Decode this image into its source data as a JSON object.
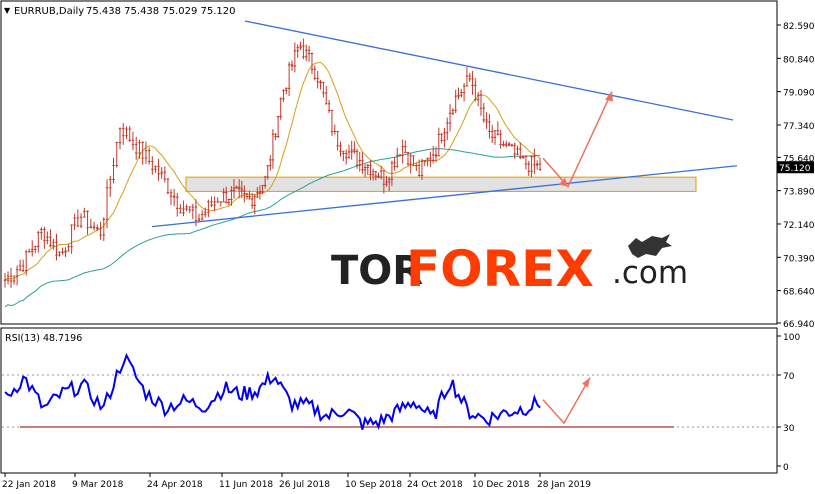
{
  "header": {
    "symbol": "EURRUB,Daily",
    "ohlc": "75.438 75.438 75.029 75.120"
  },
  "price_panel": {
    "ticks": [
      "82.590",
      "80.840",
      "79.090",
      "77.340",
      "75.640",
      "73.890",
      "72.140",
      "70.390",
      "68.640",
      "66.940"
    ],
    "current_price": "75.120"
  },
  "rsi_panel": {
    "label": "RSI(13) 48.7196",
    "levels": [
      "100",
      "70",
      "30",
      "0"
    ]
  },
  "x_ticks": [
    "22 Jan 2018",
    "9 Mar 2018",
    "24 Apr 2018",
    "11 Jun 2018",
    "26 Jul 2018",
    "10 Sep 2018",
    "24 Oct 2018",
    "10 Dec 2018",
    "28 Jan 2019"
  ],
  "watermark": {
    "part1": "TOR",
    "part2": "FOREX",
    "part3": ".com"
  },
  "colors": {
    "trendline": "#3a6fd8",
    "ma_fast": "#d4a017",
    "ma_slow": "#2aa198",
    "zone_fill": "#cfcfcf",
    "zone_border": "#e0a000",
    "forecast_arrow": "#f07060",
    "rsi_line": "#0000ee",
    "rsi_support": "#a03030",
    "candles": "#c0392b",
    "watermark_dark": "#222222",
    "watermark_accent": "#ff3c00"
  },
  "chart_data": {
    "type": "candlestick",
    "instrument": "EURRUB",
    "timeframe": "Daily",
    "ylim": [
      66.94,
      82.59
    ],
    "last": {
      "open": 75.438,
      "high": 75.438,
      "low": 75.029,
      "close": 75.12
    },
    "x": [
      "22 Jan 2018",
      "9 Mar 2018",
      "24 Apr 2018",
      "11 Jun 2018",
      "26 Jul 2018",
      "10 Sep 2018",
      "24 Oct 2018",
      "10 Dec 2018",
      "28 Jan 2019"
    ],
    "close_approx": [
      69.2,
      70.1,
      71.8,
      70.5,
      72.6,
      71.6,
      77.3,
      76.0,
      74.8,
      73.2,
      72.4,
      73.5,
      73.7,
      73.4,
      74.5,
      79.0,
      81.6,
      80.0,
      76.7,
      75.7,
      75.2,
      74.5,
      76.3,
      74.8,
      76.1,
      78.6,
      79.8,
      76.9,
      76.2,
      75.4,
      75.1
    ],
    "resistance_trendline": {
      "from": [
        "Jul 2018",
        82.8
      ],
      "to": [
        "Feb 2019",
        77.6
      ]
    },
    "support_trendline": {
      "from": [
        "Apr 2018",
        72.0
      ],
      "to": [
        "Feb 2019",
        75.2
      ]
    },
    "support_zone": [
      73.85,
      74.6
    ],
    "forecast": [
      75.6,
      74.1,
      79.1
    ],
    "rsi": {
      "period": 13,
      "value": 48.7196,
      "ylim": [
        0,
        100
      ],
      "levels": [
        30,
        70
      ],
      "values_approx": [
        52,
        68,
        44,
        56,
        62,
        44,
        84,
        57,
        45,
        50,
        46,
        60,
        55,
        58,
        70,
        48,
        46,
        38,
        44,
        32,
        34,
        42,
        50,
        36,
        66,
        42,
        36,
        41,
        44,
        48.7
      ],
      "forecast": [
        51,
        33,
        68
      ]
    }
  }
}
